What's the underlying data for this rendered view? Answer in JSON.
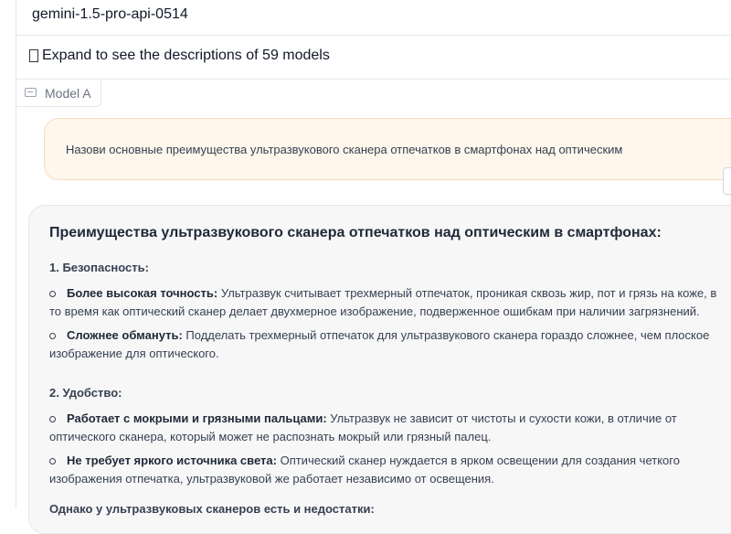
{
  "model_selector": {
    "value": "gemini-1.5-pro-api-0514"
  },
  "expand_toggle": {
    "label": "Expand to see the descriptions of 59 models"
  },
  "model_tag": {
    "label": "Model A"
  },
  "user_message": "Назови основные преимущества ультразвукового сканера отпечатков в смартфонах над оптическим",
  "response": {
    "title": "Преимущества ультразвукового сканера отпечатков над оптическим в смартфонах:",
    "sections": [
      {
        "heading": "1. Безопасность:",
        "items": [
          {
            "bold": "Более высокая точность:",
            "text": " Ультразвук считывает трехмерный отпечаток, проникая сквозь жир, пот и грязь на коже, в то время как оптический сканер делает двухмерное изображение, подверженное ошибкам при наличии загрязнений."
          },
          {
            "bold": "Сложнее обмануть:",
            "text": " Подделать трехмерный отпечаток для ультразвукового сканера гораздо сложнее, чем плоское изображение для оптического."
          }
        ]
      },
      {
        "heading": "2. Удобство:",
        "items": [
          {
            "bold": "Работает с мокрыми и грязными пальцами:",
            "text": " Ультразвук не зависит от чистоты и сухости кожи, в отличие от оптического сканера, который может не распознать мокрый или грязный палец."
          },
          {
            "bold": "Не требует яркого источника света:",
            "text": " Оптический сканер нуждается в ярком освещении для создания четкого изображения отпечатка, ультразвуковой же работает независимо от освещения."
          }
        ]
      }
    ],
    "footer": "Однако у ультразвуковых сканеров есть и недостатки:"
  }
}
